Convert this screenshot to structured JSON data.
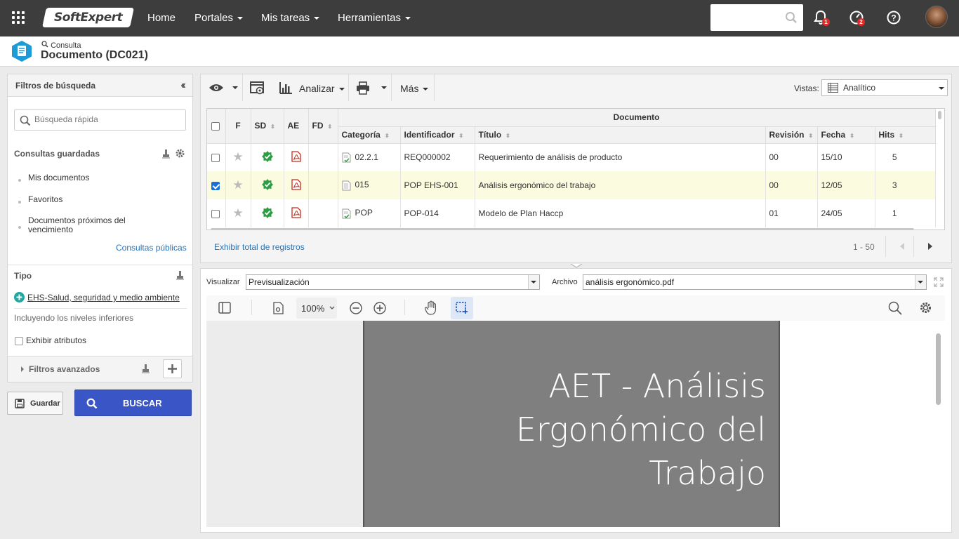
{
  "topbar": {
    "logo": "SoftExpert",
    "nav": [
      {
        "label": "Home",
        "has_caret": false
      },
      {
        "label": "Portales",
        "has_caret": true
      },
      {
        "label": "Mis tareas",
        "has_caret": true
      },
      {
        "label": "Herramientas",
        "has_caret": true
      }
    ],
    "search_placeholder": "",
    "notifications_badge": "1",
    "tasks_badge": "2",
    "icons": [
      "apps-grid-icon",
      "search-icon",
      "bell-icon",
      "gauge-icon",
      "help-icon",
      "avatar"
    ]
  },
  "header": {
    "breadcrumb": "Consulta",
    "title": "Documento (DC021)"
  },
  "filters": {
    "title": "Filtros de búsqueda",
    "quick_search_placeholder": "Búsqueda rápida",
    "saved_title": "Consultas guardadas",
    "saved_items": [
      "Mis documentos",
      "Favoritos",
      "Documentos próximos del vencimiento"
    ],
    "public_link": "Consultas públicas",
    "tipo_title": "Tipo",
    "tipo_value": "EHS-Salud, seguridad y medio ambiente",
    "tipo_note": "Incluyendo los niveles inferiores",
    "show_attrs": "Exhibir atributos",
    "advanced": "Filtros avanzados"
  },
  "actions": {
    "save": "Guardar",
    "search": "BUSCAR"
  },
  "toolbar": {
    "analyze": "Analizar",
    "more": "Más",
    "views_label": "Vistas:",
    "views_value": "Analítico"
  },
  "grid": {
    "group_header": "Documento",
    "columns": [
      "F",
      "SD",
      "AE",
      "FD",
      "Categoría",
      "Identificador",
      "Título",
      "Revisión",
      "Fecha",
      "Hits"
    ],
    "rows": [
      {
        "checked": false,
        "category": "02.2.1",
        "id": "REQ000002",
        "title": "Requerimiento de análisis de producto",
        "revision": "00",
        "date": "15/10",
        "hits": "5"
      },
      {
        "checked": true,
        "category": "015",
        "id": "POP EHS-001",
        "title": "Análisis ergonómico del trabajo",
        "revision": "00",
        "date": "12/05",
        "hits": "3"
      },
      {
        "checked": false,
        "category": "POP",
        "id": "POP-014",
        "title": "Modelo de Plan Haccp",
        "revision": "01",
        "date": "24/05",
        "hits": "1"
      }
    ],
    "show_total": "Exhibir total de registros",
    "range": "1 - 50"
  },
  "preview": {
    "view_label": "Visualizar",
    "view_value": "Previsualización",
    "file_label": "Archivo",
    "file_value": "análisis ergonómico.pdf",
    "zoom": "100%",
    "page_title_lines": [
      "AET - Análisis",
      "Ergonómico del",
      "Trabajo"
    ]
  },
  "colors": {
    "topbar": "#3d3d3d",
    "accent": "#3a56c6",
    "link": "#2b72b5",
    "selected_row": "#fbfbdf",
    "badge": "#e02b2b",
    "status_ok": "#2a9d45",
    "ehs_plus": "#1fa7a0"
  }
}
